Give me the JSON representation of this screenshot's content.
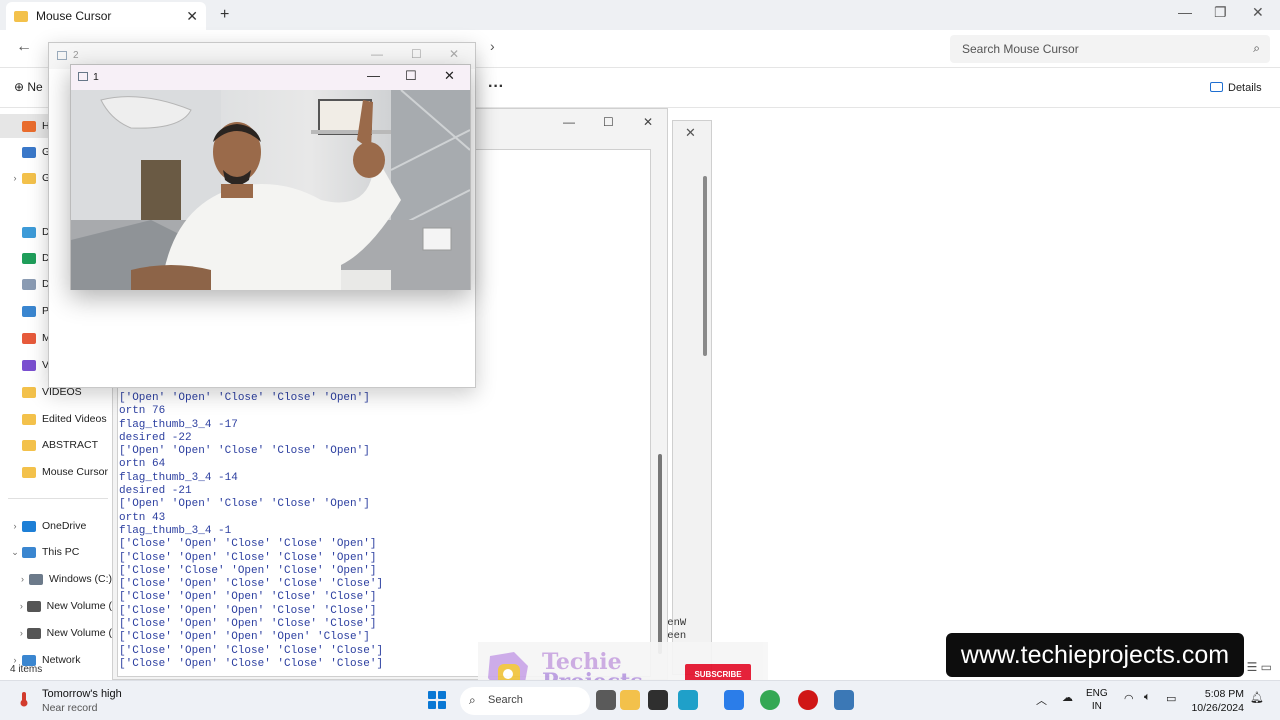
{
  "explorer": {
    "tab_title": "Mouse Cursor",
    "search_placeholder": "Search Mouse Cursor",
    "new_label": "Ne",
    "details_label": "Details",
    "status_items": "4 items",
    "sidebar": [
      {
        "label": "H",
        "color": "#e96c2d",
        "selected": true
      },
      {
        "label": "G",
        "color": "#3a78c9"
      },
      {
        "label": "G",
        "color": "#f3c14b",
        "chevron": true
      },
      {
        "label": "D",
        "color": "#3d9bd8"
      },
      {
        "label": "D",
        "color": "#1f9e5a"
      },
      {
        "label": "D",
        "color": "#8a9bb3"
      },
      {
        "label": "P",
        "color": "#3a86d0"
      },
      {
        "label": "M",
        "color": "#e75a3b"
      },
      {
        "label": "V",
        "color": "#7a4fd0"
      },
      {
        "label": "VIDEOS",
        "color": "#f3c14b"
      },
      {
        "label": "Edited Videos",
        "color": "#f3c14b"
      },
      {
        "label": "ABSTRACT",
        "color": "#f3c14b"
      },
      {
        "label": "Mouse Cursor",
        "color": "#f3c14b"
      }
    ],
    "sidebar_bottom": [
      {
        "label": "OneDrive",
        "color": "#1e7fd6",
        "chevron": "right"
      },
      {
        "label": "This PC",
        "color": "#3a86d0",
        "chevron": "down"
      },
      {
        "label": "Windows (C:)",
        "color": "#6c7a8a",
        "chevron": "right",
        "indent": true
      },
      {
        "label": "New Volume (",
        "color": "#555",
        "chevron": "right",
        "indent": true
      },
      {
        "label": "New Volume (",
        "color": "#555",
        "chevron": "right",
        "indent": true
      },
      {
        "label": "Network",
        "color": "#3a86d0",
        "chevron": "right"
      }
    ]
  },
  "console": {
    "lines": [
      "['Open' 'Open' 'Close' 'Close' 'Open']",
      "ortn 76",
      "flag_thumb_3_4 -17",
      "desired -22",
      "['Open' 'Open' 'Close' 'Close' 'Open']",
      "ortn 64",
      "flag_thumb_3_4 -14",
      "desired -21",
      "['Open' 'Open' 'Close' 'Close' 'Open']",
      "ortn 43",
      "flag_thumb_3_4 -1",
      "['Close' 'Open' 'Close' 'Close' 'Open']",
      "['Close' 'Open' 'Close' 'Close' 'Open']",
      "['Close' 'Close' 'Open' 'Close' 'Open']",
      "['Close' 'Open' 'Close' 'Close' 'Close']",
      "['Close' 'Open' 'Open' 'Close' 'Close']",
      "['Close' 'Open' 'Open' 'Close' 'Close']",
      "['Close' 'Open' 'Open' 'Close' 'Close']",
      "['Close' 'Open' 'Open' 'Open' 'Close']",
      "['Close' 'Open' 'Close' 'Close' 'Close']",
      "['Close' 'Open' 'Close' 'Close' 'Close']"
    ],
    "glimpse_lines": [
      "eenW",
      "reen"
    ]
  },
  "window2": {
    "title": "2"
  },
  "window1": {
    "title": "1"
  },
  "overlay": {
    "url": "www.techieprojects.com",
    "logo_line1": "Techie",
    "logo_line2": "Projects",
    "subscribe": "SUBSCRIBE"
  },
  "taskbar": {
    "weather_title": "Tomorrow's high",
    "weather_sub": "Near record",
    "search_label": "Search",
    "lang_line1": "ENG",
    "lang_line2": "IN",
    "time": "5:08 PM",
    "date": "10/26/2024",
    "apps": [
      {
        "name": "task-view-icon",
        "color": "#5a5a5a"
      },
      {
        "name": "file-explorer-icon",
        "color": "#f3c14b"
      },
      {
        "name": "store-icon",
        "color": "#2f2f2f"
      },
      {
        "name": "edge-icon",
        "color": "#1fa0c9"
      },
      {
        "name": "photos-icon",
        "color": "#2b7de9"
      },
      {
        "name": "chrome-icon",
        "color": "#34a853"
      },
      {
        "name": "record-icon",
        "color": "#d01616"
      },
      {
        "name": "python-icon",
        "color": "#3b78b6"
      }
    ]
  }
}
